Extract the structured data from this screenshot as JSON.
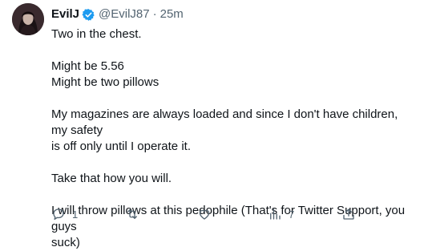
{
  "tweet": {
    "name": "EvilJ",
    "handle": "@EvilJ87",
    "separator": "·",
    "time": "25m",
    "lines": {
      "l1": "Two in the chest.",
      "l2": "Might be 5.56",
      "l3": "Might be two pillows",
      "l4": "My magazines are always loaded and since I don't have children, my safety",
      "l5": "is off only until I operate it.",
      "l6": "Take that how you will.",
      "l7": "I will throw pillows at this pedophile (That's for Twitter Support, you guys",
      "l8": "suck)"
    },
    "icons": {
      "avatar": "profile-avatar",
      "verified": "verified-badge-icon",
      "reply": "reply-icon",
      "retweet": "retweet-icon",
      "like": "heart-icon",
      "views": "views-icon",
      "share": "share-icon"
    },
    "actions": {
      "reply_count": "1",
      "views_count": "7"
    },
    "colors": {
      "text": "#0f1419",
      "secondary": "#536471",
      "verified_blue": "#1d9bf0"
    }
  }
}
